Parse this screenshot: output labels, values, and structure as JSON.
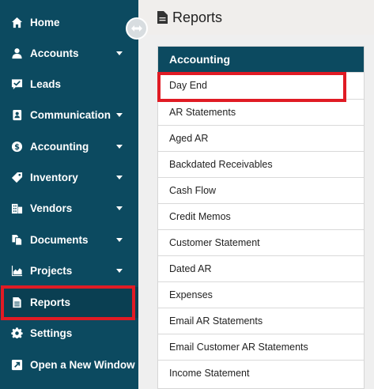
{
  "sidebar": {
    "background": "#0c4a60",
    "items": [
      {
        "label": "Home",
        "icon": "home-icon",
        "has_caret": false
      },
      {
        "label": "Accounts",
        "icon": "user-icon",
        "has_caret": true
      },
      {
        "label": "Leads",
        "icon": "check-message-icon",
        "has_caret": false
      },
      {
        "label": "Communication",
        "icon": "contact-book-icon",
        "has_caret": true
      },
      {
        "label": "Accounting",
        "icon": "dollar-circle-icon",
        "has_caret": true
      },
      {
        "label": "Inventory",
        "icon": "tag-icon",
        "has_caret": true
      },
      {
        "label": "Vendors",
        "icon": "building-icon",
        "has_caret": true
      },
      {
        "label": "Documents",
        "icon": "files-icon",
        "has_caret": true
      },
      {
        "label": "Projects",
        "icon": "area-chart-icon",
        "has_caret": true
      },
      {
        "label": "Reports",
        "icon": "document-icon",
        "has_caret": false
      },
      {
        "label": "Settings",
        "icon": "gear-icon",
        "has_caret": false
      },
      {
        "label": "Open a New Window",
        "icon": "external-link-icon",
        "has_caret": false
      }
    ],
    "active_item": "Reports"
  },
  "header": {
    "title": "Reports",
    "icon": "document-icon"
  },
  "panel": {
    "title": "Accounting",
    "items": [
      "Day End",
      "AR Statements",
      "Aged AR",
      "Backdated Receivables",
      "Cash Flow",
      "Credit Memos",
      "Customer Statement",
      "Dated AR",
      "Expenses",
      "Email AR Statements",
      "Email Customer AR Statements",
      "Income Statement"
    ],
    "highlighted_item": "Day End"
  },
  "colors": {
    "highlight": "#e01b24",
    "panel_header": "#0c4a60"
  }
}
